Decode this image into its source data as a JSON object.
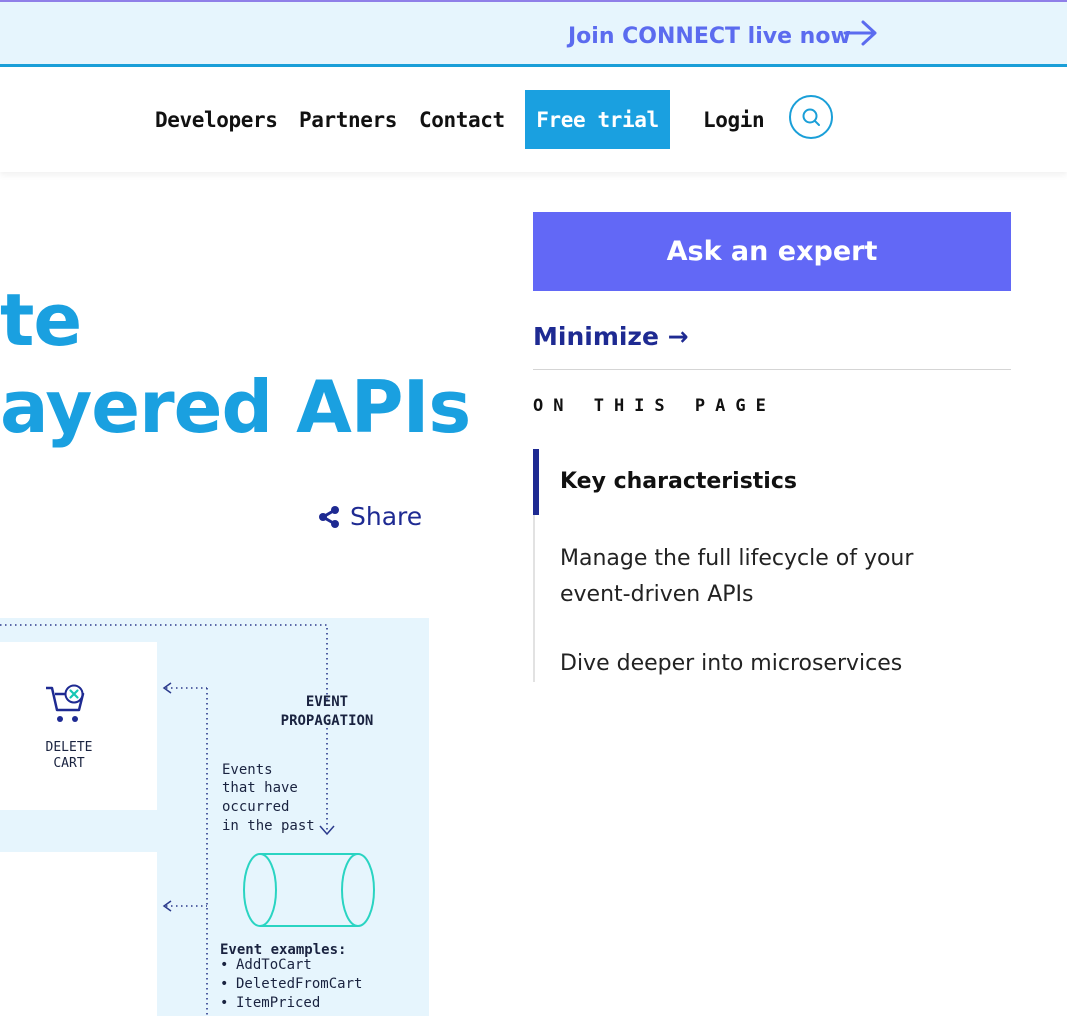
{
  "promo": {
    "text": "Join CONNECT live now",
    "arrow_icon": "arrow-right-icon",
    "color": "#5b6bef"
  },
  "nav": {
    "links": [
      "Developers",
      "Partners",
      "Contact"
    ],
    "free_trial": "Free trial",
    "login": "Login",
    "search_icon": "search-icon",
    "accent": "#1aa0e0"
  },
  "hero": {
    "title_lines": [
      "te",
      "ayered APIs"
    ]
  },
  "share": {
    "label": "Share",
    "icon": "share-icon"
  },
  "diagram": {
    "delete_cart": [
      "DELETE",
      "CART"
    ],
    "event_propagation": [
      "EVENT",
      "PROPAGATION"
    ],
    "events_note": [
      "Events",
      "that have",
      "occurred",
      "in the past"
    ],
    "event_examples_title": "Event examples:",
    "event_examples": [
      "AddToCart",
      "DeletedFromCart",
      "ItemPriced"
    ]
  },
  "sidebar": {
    "ask_expert": "Ask an expert",
    "minimize": "Minimize →",
    "on_this_page": "ON THIS PAGE",
    "toc": [
      {
        "label": "Key characteristics",
        "active": true
      },
      {
        "label": "Manage the full lifecycle of your event-driven APIs",
        "active": false
      },
      {
        "label": "Dive deeper into microservices",
        "active": false
      }
    ],
    "button_color": "#6268f6",
    "link_color": "#1e2a92"
  }
}
